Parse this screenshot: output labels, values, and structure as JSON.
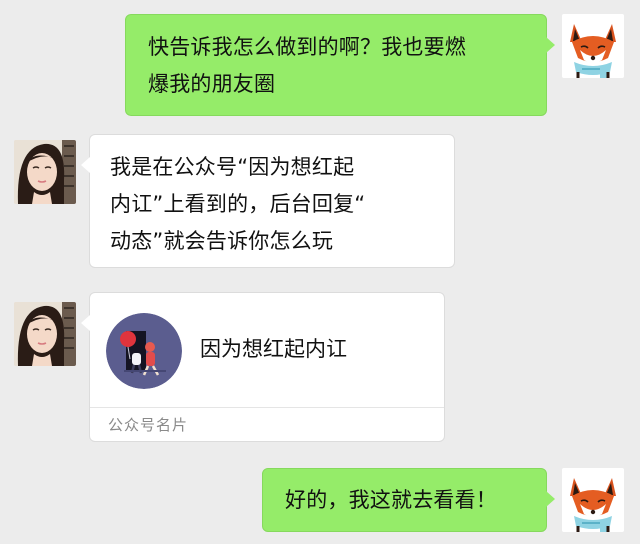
{
  "chat": {
    "messages": [
      {
        "side": "sent",
        "lines": [
          "快告诉我怎么做到的啊？我也要燃",
          "爆我的朋友圈"
        ]
      },
      {
        "side": "received",
        "lines": [
          "我是在公众号“因为想红起",
          "内讧”上看到的，后台回复“",
          "动态”就会告诉你怎么玩"
        ]
      },
      {
        "side": "received",
        "type": "official_account_card",
        "account_name": "因为想红起内讧",
        "footer_label": "公众号名片"
      },
      {
        "side": "sent",
        "lines": [
          "好的，我这就去看看！"
        ]
      }
    ]
  },
  "avatars": {
    "self": "fox-avatar",
    "contact": "girl-avatar"
  },
  "colors": {
    "background": "#ececec",
    "sent_bubble": "#95ec69",
    "received_bubble": "#ffffff",
    "card_footer_text": "#8a8a8a",
    "card_logo": "#5b5d8f"
  }
}
